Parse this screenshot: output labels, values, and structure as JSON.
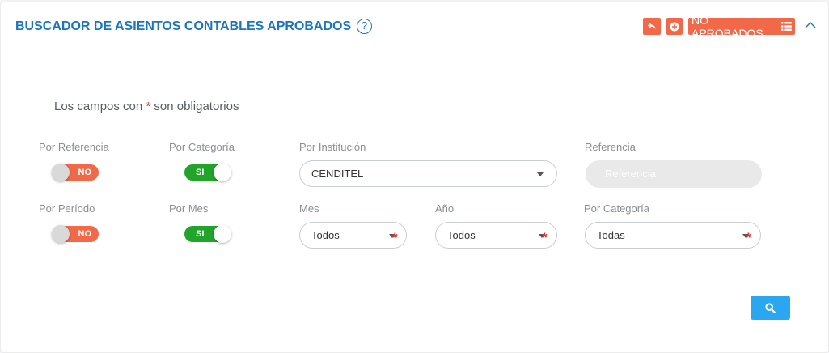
{
  "header": {
    "title": "BUSCADOR DE ASIENTOS CONTABLES APROBADOS",
    "help_glyph": "?",
    "no_aprobados_label": "NO APROBADOS",
    "accent_color": "#f2694a",
    "title_color": "#1c75bc"
  },
  "form": {
    "required_note_prefix": "Los campos con ",
    "required_star": "*",
    "required_note_suffix": " son obligatorios",
    "por_referencia": {
      "label": "Por Referencia",
      "state": "NO"
    },
    "por_categoria_toggle": {
      "label": "Por Categoría",
      "state": "SI"
    },
    "por_institucion": {
      "label": "Por Institución",
      "value": "CENDITEL"
    },
    "referencia": {
      "label": "Referencia",
      "placeholder": "Referencia"
    },
    "por_periodo": {
      "label": "Por Período",
      "state": "NO"
    },
    "por_mes": {
      "label": "Por Mes",
      "state": "SI"
    },
    "mes": {
      "label": "Mes",
      "value": "Todos"
    },
    "anio": {
      "label": "Año",
      "value": "Todos"
    },
    "por_categoria_select": {
      "label": "Por Categoría",
      "value": "Todas"
    }
  },
  "icons": {
    "back": "undo-icon",
    "add": "plus-circle-icon",
    "list": "list-icon",
    "collapse": "chevron-up-icon",
    "search": "search-icon"
  }
}
